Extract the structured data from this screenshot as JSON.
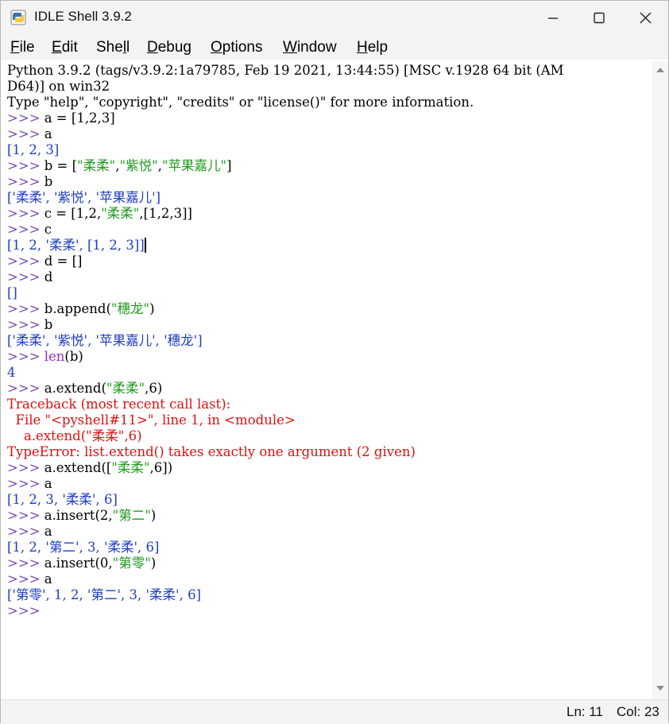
{
  "window": {
    "title": "IDLE Shell 3.9.2"
  },
  "menu": [
    {
      "key": "F",
      "rest": "ile"
    },
    {
      "key": "E",
      "rest": "dit"
    },
    {
      "pre": "She",
      "key": "l",
      "rest": "l"
    },
    {
      "key": "D",
      "rest": "ebug"
    },
    {
      "key": "O",
      "rest": "ptions"
    },
    {
      "key": "W",
      "rest": "indow"
    },
    {
      "key": "H",
      "rest": "elp"
    }
  ],
  "shell_lines": [
    "Python 3.9.2 (tags/v3.9.2:1a79785, Feb 19 2021, 13:44:55) [MSC v.1928 64 bit (AM",
    "D64)] on win32",
    "Type \"help\", \"copyright\", \"credits\" or \"license()\" for more information.",
    ">>> a = [1,2,3]",
    ">>> a",
    "[1, 2, 3]",
    ">>> b = [\"柔柔\",\"紫悦\",\"苹果嘉儿\"]",
    ">>> b",
    "['柔柔', '紫悦', '苹果嘉儿']",
    ">>> c = [1,2,\"柔柔\",[1,2,3]]",
    ">>> c",
    "[1, 2, '柔柔', [1, 2, 3]]",
    ">>> d = []",
    ">>> d",
    "[]",
    ">>> b.append(\"穗龙\")",
    ">>> b",
    "['柔柔', '紫悦', '苹果嘉儿', '穗龙']",
    ">>> len(b)",
    "4",
    ">>> a.extend(\"柔柔\",6)",
    "Traceback (most recent call last):",
    "  File \"<pyshell#11>\", line 1, in <module>",
    "    a.extend(\"柔柔\",6)",
    "TypeError: list.extend() takes exactly one argument (2 given)",
    ">>> a.extend([\"柔柔\",6])",
    ">>> a",
    "[1, 2, 3, '柔柔', 6]",
    ">>> a.insert(2,\"第二\")",
    ">>> a",
    "[1, 2, '第二', 3, '柔柔', 6]",
    ">>> a.insert(0,\"第零\")",
    ">>> a",
    "['第零', 1, 2, '第二', 3, '柔柔', 6]",
    ">>>"
  ],
  "status": {
    "ln": "Ln: 11",
    "col": "Col: 23"
  },
  "colors": {
    "prompt": "#7a4bb5",
    "output": "#1f3fc2",
    "string": "#1f9a1f",
    "error": "#e01010",
    "builtin": "#9a2bc4"
  }
}
